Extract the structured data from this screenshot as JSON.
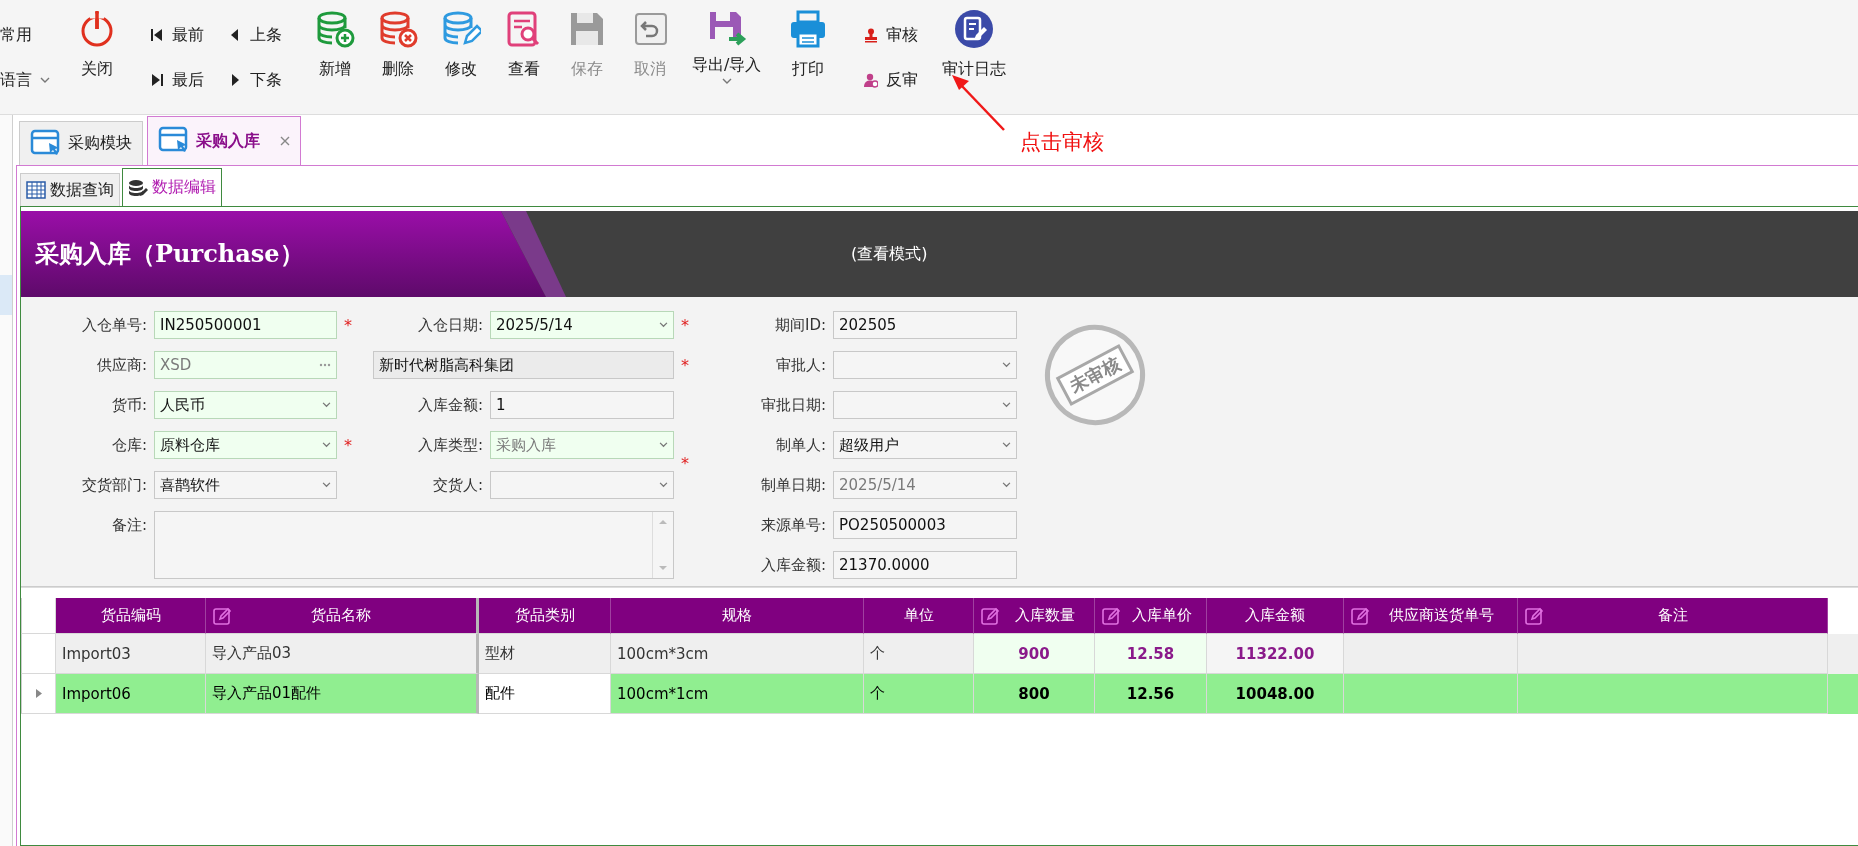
{
  "toolbar": {
    "items": [
      {
        "kind": "stack",
        "entries": [
          {
            "label": "常用",
            "caret": false
          },
          {
            "label": "语言",
            "caret": true
          }
        ]
      },
      {
        "kind": "big",
        "label": "关闭",
        "disabled": false,
        "caret": false
      },
      {
        "kind": "stack",
        "entries": [
          {
            "label": "最前",
            "caret": false
          },
          {
            "label": "最后",
            "caret": false
          }
        ]
      },
      {
        "kind": "stack",
        "entries": [
          {
            "label": "上条",
            "caret": false
          },
          {
            "label": "下条",
            "caret": false
          }
        ]
      },
      {
        "kind": "big",
        "label": "新增",
        "disabled": false,
        "caret": false
      },
      {
        "kind": "big",
        "label": "删除",
        "disabled": false,
        "caret": false
      },
      {
        "kind": "big",
        "label": "修改",
        "disabled": false,
        "caret": false
      },
      {
        "kind": "big",
        "label": "查看",
        "disabled": false,
        "caret": false
      },
      {
        "kind": "big",
        "label": "保存",
        "disabled": true,
        "caret": false
      },
      {
        "kind": "big",
        "label": "取消",
        "disabled": true,
        "caret": false
      },
      {
        "kind": "big",
        "label": "导出/导入",
        "disabled": false,
        "caret": true
      },
      {
        "kind": "big",
        "label": "打印",
        "disabled": false,
        "caret": false
      },
      {
        "kind": "stack",
        "entries": [
          {
            "label": "审核",
            "caret": false
          },
          {
            "label": "反审",
            "caret": false
          }
        ]
      },
      {
        "kind": "big",
        "label": "审计日志",
        "disabled": false,
        "caret": false
      }
    ]
  },
  "annotation": {
    "text": "点击审核"
  },
  "doc_tabs": [
    {
      "label": "采购模块",
      "selected": false,
      "closable": false
    },
    {
      "label": "采购入库",
      "selected": true,
      "closable": true
    }
  ],
  "sub_tabs": [
    {
      "label": "数据查询",
      "selected": false
    },
    {
      "label": "数据编辑",
      "selected": true
    }
  ],
  "banner": {
    "title": "采购入库（Purchase）",
    "mode": "(查看模式)"
  },
  "form": {
    "columns": [
      [
        {
          "label": "入仓单号:",
          "kind": "text",
          "value": "IN250500001",
          "required_mark": "*",
          "highlighted": true,
          "dimmed": false
        },
        {
          "label": "供应商:",
          "kind": "lookup",
          "value": "XSD",
          "highlighted": true,
          "dimmed": true
        },
        {
          "label": "货币:",
          "kind": "combo",
          "value": "人民币",
          "highlighted": true,
          "dimmed": false
        },
        {
          "label": "仓库:",
          "kind": "combo",
          "value": "原料仓库",
          "required_mark": "*",
          "highlighted": true,
          "dimmed": false
        },
        {
          "label": "交货部门:",
          "kind": "combo",
          "value": "喜鹊软件",
          "highlighted": false,
          "dimmed": false
        },
        {
          "label": "备注:",
          "kind": "memo",
          "highlighted": false
        }
      ],
      [
        {
          "label": "入仓日期:",
          "kind": "combo",
          "value": "2025/5/14",
          "required_mark": "*",
          "highlighted": true,
          "dimmed": false
        },
        {
          "kind": "name",
          "value": "新时代树脂高科集团",
          "required_mark": "*",
          "highlighted": false,
          "dimmed": false
        },
        {
          "label": "入库金额:",
          "kind": "text",
          "value": "1",
          "highlighted": false,
          "dimmed": false
        },
        {
          "label": "入库类型:",
          "kind": "combo",
          "value": "采购入库",
          "required_mark": "*",
          "highlighted": true,
          "dimmed": true
        },
        {
          "label": "交货人:",
          "kind": "combo",
          "highlighted": false
        }
      ],
      [
        {
          "label": "期间ID:",
          "kind": "text",
          "value": "202505",
          "highlighted": false,
          "dimmed": false
        },
        {
          "label": "审批人:",
          "kind": "combo",
          "highlighted": false
        },
        {
          "label": "审批日期:",
          "kind": "combo",
          "highlighted": false
        },
        {
          "label": "制单人:",
          "kind": "combo",
          "value": "超级用户",
          "highlighted": false,
          "dimmed": false
        },
        {
          "label": "制单日期:",
          "kind": "combo",
          "value": "2025/5/14",
          "highlighted": false,
          "dimmed": true
        },
        {
          "label": "来源单号:",
          "kind": "text",
          "value": "PO250500003",
          "highlighted": false,
          "dimmed": false
        },
        {
          "label": "入库金额:",
          "kind": "text",
          "value": "21370.0000",
          "highlighted": false,
          "dimmed": false
        }
      ]
    ],
    "stamp": "未审核"
  },
  "grid": {
    "columns": [
      {
        "label": "货品编码",
        "editable": false,
        "kind": "text"
      },
      {
        "label": "货品名称",
        "editable": true,
        "kind": "text"
      },
      {
        "label": "货品类别",
        "editable": false,
        "kind": "text"
      },
      {
        "label": "规格",
        "editable": false,
        "kind": "text"
      },
      {
        "label": "单位",
        "editable": false,
        "kind": "text"
      },
      {
        "label": "入库数量",
        "editable": true,
        "kind": "number"
      },
      {
        "label": "入库单价",
        "editable": true,
        "kind": "number"
      },
      {
        "label": "入库金额",
        "editable": false,
        "kind": "number"
      },
      {
        "label": "供应商送货单号",
        "editable": true,
        "kind": "text"
      },
      {
        "label": "备注",
        "editable": true,
        "kind": "text"
      }
    ],
    "rows": [
      {
        "selected": false,
        "cells": [
          {
            "text": "Import03",
            "focused": false
          },
          {
            "text": "导入产品03",
            "focused": false
          },
          {
            "text": "型材",
            "focused": false
          },
          {
            "text": "100cm*3cm",
            "focused": false
          },
          {
            "text": "个",
            "focused": false
          },
          {
            "text": "900",
            "focused": false
          },
          {
            "text": "12.58",
            "focused": false
          },
          {
            "text": "11322.00",
            "focused": false
          },
          {
            "focused": false
          },
          {
            "focused": false
          }
        ]
      },
      {
        "selected": true,
        "cells": [
          {
            "text": "Import06",
            "focused": false
          },
          {
            "text": "导入产品01配件",
            "focused": false
          },
          {
            "text": "配件",
            "focused": true
          },
          {
            "text": "100cm*1cm",
            "focused": false
          },
          {
            "text": "个",
            "focused": false
          },
          {
            "text": "800",
            "focused": false
          },
          {
            "text": "12.56",
            "focused": false
          },
          {
            "text": "10048.00",
            "focused": false
          },
          {
            "focused": false
          },
          {
            "focused": false
          }
        ]
      }
    ]
  }
}
